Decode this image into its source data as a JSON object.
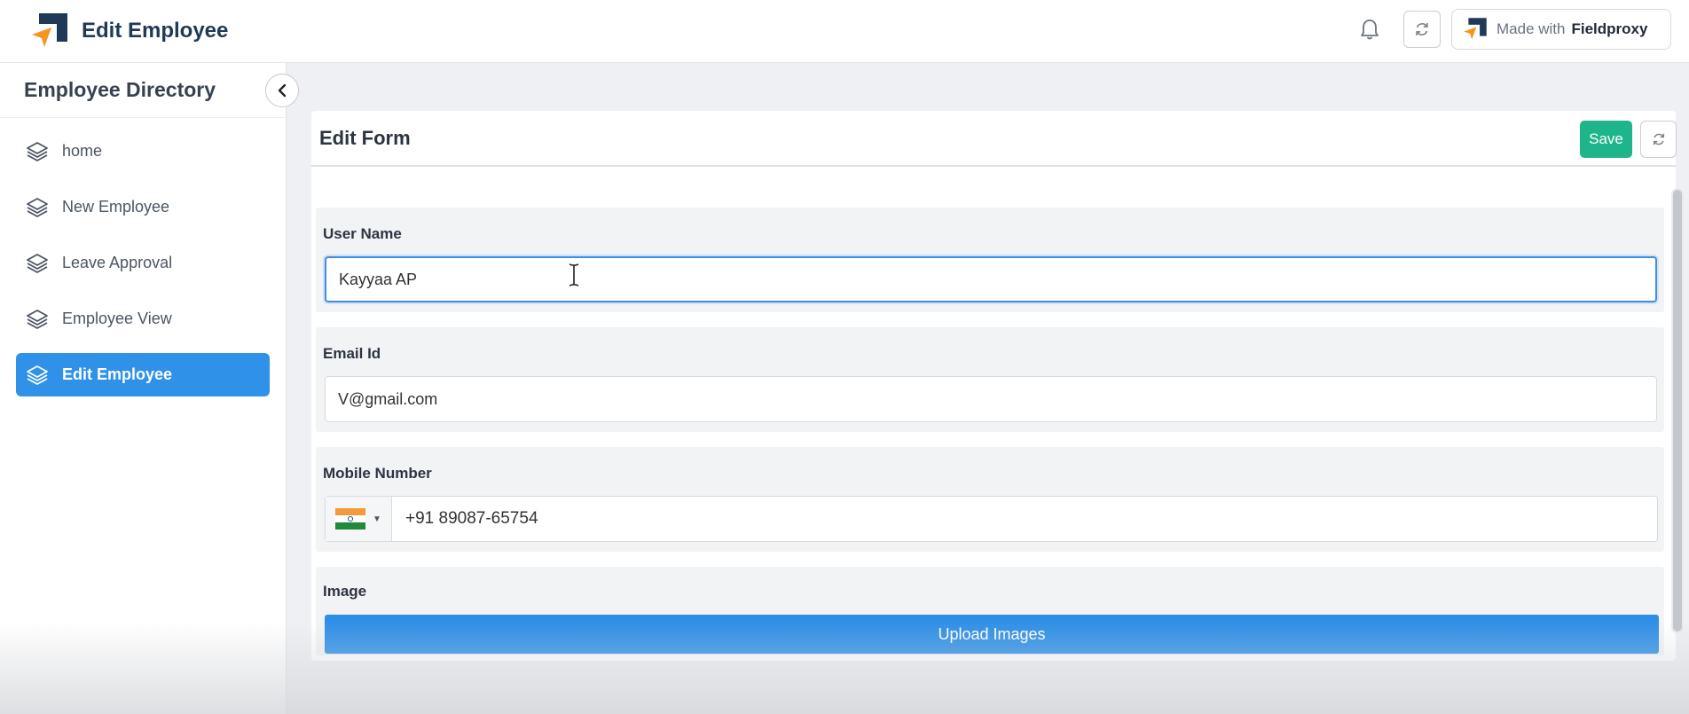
{
  "app": {
    "title": "Edit Employee",
    "brand_color": "#1f3a56",
    "accent_color": "#f7941d"
  },
  "topbar": {
    "bell_icon": "bell-icon",
    "refresh_icon": "refresh-icon",
    "made_with_text": "Made with",
    "made_with_brand": "Fieldproxy"
  },
  "sidebar": {
    "title": "Employee Directory",
    "collapse_icon": "chevron-left-icon",
    "items": [
      {
        "label": "home",
        "icon": "layers-icon",
        "active": false
      },
      {
        "label": "New Employee",
        "icon": "layers-icon",
        "active": false
      },
      {
        "label": "Leave Approval",
        "icon": "layers-icon",
        "active": false
      },
      {
        "label": "Employee View",
        "icon": "layers-icon",
        "active": false
      },
      {
        "label": "Edit Employee",
        "icon": "layers-icon",
        "active": true
      }
    ],
    "active_color": "#2f91e8"
  },
  "form": {
    "title": "Edit Form",
    "save_label": "Save",
    "save_color": "#1fb58a",
    "fields": {
      "user_name": {
        "label": "User Name",
        "value": "Kayyaa AP"
      },
      "email": {
        "label": "Email Id",
        "value": "V@gmail.com"
      },
      "mobile": {
        "label": "Mobile Number",
        "country": "India",
        "value": "+91 89087-65754"
      },
      "image": {
        "label": "Image",
        "button_label": "Upload Images"
      }
    }
  }
}
